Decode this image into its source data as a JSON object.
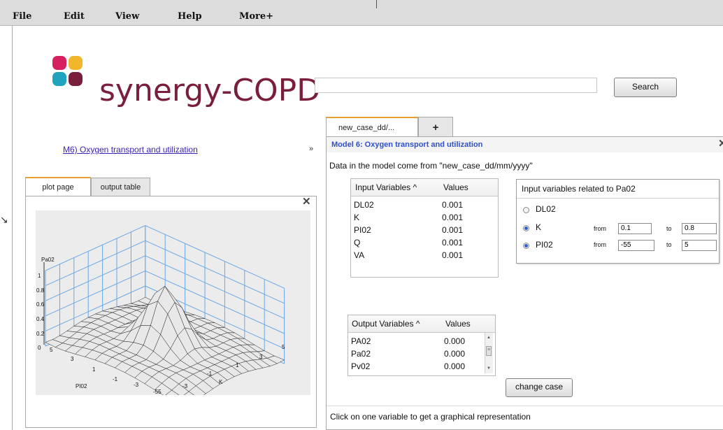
{
  "menu": [
    "File",
    "Edit",
    "View",
    "Help",
    "More+"
  ],
  "logo": {
    "text": "synergy-COPD",
    "colors": [
      "#d6205f",
      "#f2b62a",
      "#1fa3bf",
      "#7a1f3b"
    ]
  },
  "search": {
    "value": "",
    "button": "Search"
  },
  "model_link": "M6) Oxygen transport and utilization",
  "raquo": "»",
  "left_tabs": [
    "plot page",
    "output table"
  ],
  "plot": {
    "zlabel": "Pa02",
    "ylabel": "PI02",
    "xlabel": "K",
    "zticks": [
      "1",
      "0.8",
      "0.6",
      "0.4",
      "0.2",
      "0"
    ],
    "pi_ticks": [
      "5",
      "3",
      "1",
      "-1",
      "-3",
      "-55"
    ],
    "k_ticks": [
      "-3",
      "-1",
      "1",
      "3",
      "5"
    ]
  },
  "right_tabs": {
    "active": "new_case_dd/...",
    "add": "+"
  },
  "model": {
    "title": "Model 6: Oxygen transport and utilization",
    "data_source": "Data in the model come from \"new_case_dd/mm/yyyy\""
  },
  "input_table": {
    "headers": [
      "Input Variables ^",
      "Values"
    ],
    "rows": [
      [
        "DL02",
        "0.001"
      ],
      [
        "K",
        "0.001"
      ],
      [
        "PI02",
        "0.001"
      ],
      [
        "Q",
        "0.001"
      ],
      [
        "VA",
        "0.001"
      ]
    ]
  },
  "related": {
    "title": "Input variables related to Pa02",
    "items": [
      {
        "label": "DL02",
        "checked": false
      },
      {
        "label": "K",
        "checked": true,
        "from": "0.1",
        "to": "0.8"
      },
      {
        "label": "PI02",
        "checked": true,
        "from": "-55",
        "to": "5"
      }
    ],
    "from_label": "from",
    "to_label": "to"
  },
  "output_table": {
    "headers": [
      "Output Variables ^",
      "Values"
    ],
    "rows": [
      [
        "PA02",
        "0.000"
      ],
      [
        "Pa02",
        "0.000"
      ],
      [
        "Pv02",
        "0.000"
      ]
    ]
  },
  "change_button": "change case",
  "hint": "Click on one variable to get a graphical representation"
}
